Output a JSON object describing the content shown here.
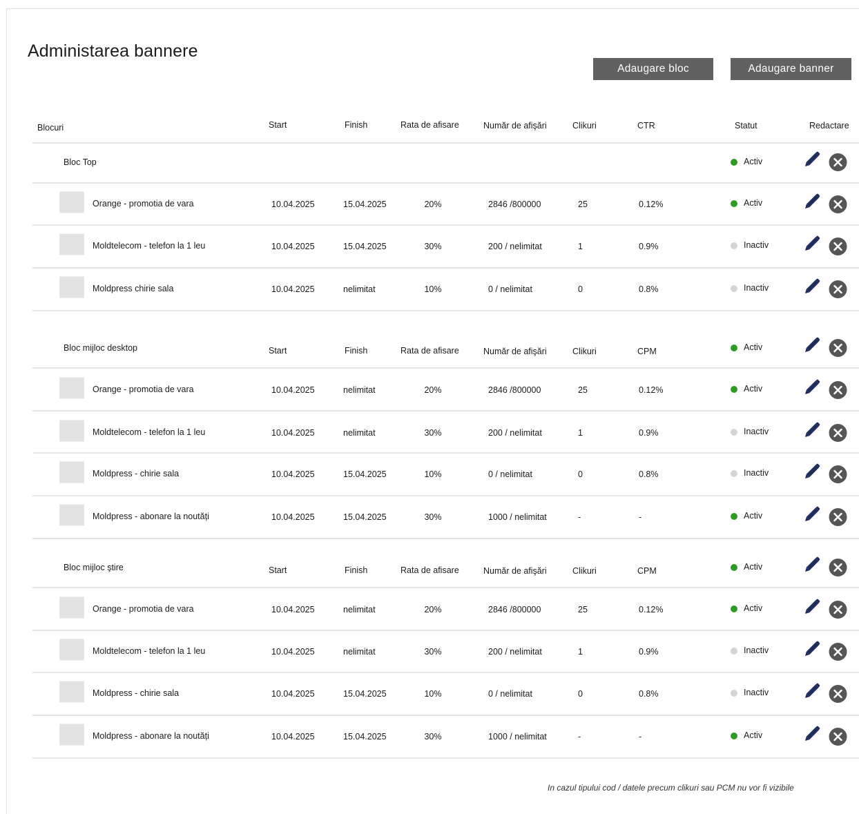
{
  "page": {
    "title": "Administarea bannere"
  },
  "actions": {
    "add_block": "Adaugare bloc",
    "add_banner": "Adaugare banner"
  },
  "columns": {
    "blocks": "Blocuri",
    "start": "Start",
    "finish": "Finish",
    "rate": "Rata de afisare",
    "impressions": "Număr de afişări",
    "clicks": "Clikuri",
    "ctr": "CTR",
    "cpm": "CPM",
    "status": "Statut",
    "edit": "Redactare"
  },
  "colors": {
    "active": "#2f9b24",
    "inactive": "#d4d4d4",
    "button": "#616161",
    "icon": "#1f2d5c",
    "delete": "#555555"
  },
  "icons": {
    "edit": "pencil-icon",
    "delete": "close-circle-icon"
  },
  "blocks": [
    {
      "name": "Bloc Top",
      "status": "Activ",
      "active": true,
      "metric_label": "CTR",
      "banners": [
        {
          "name": "Orange - promotia de vara",
          "start": "10.04.2025",
          "finish": "15.04.2025",
          "rate": "20%",
          "impressions": "2846 /800000",
          "clicks": "25",
          "metric": "0.12%",
          "status": "Activ",
          "active": true
        },
        {
          "name": "Moldtelecom - telefon la 1 leu",
          "start": "10.04.2025",
          "finish": "15.04.2025",
          "rate": "30%",
          "impressions": "200 / nelimitat",
          "clicks": "1",
          "metric": "0.9%",
          "status": "Inactiv",
          "active": false
        },
        {
          "name": "Moldpress chirie sala",
          "start": "10.04.2025",
          "finish": "nelimitat",
          "rate": "10%",
          "impressions": "0 / nelimitat",
          "clicks": "0",
          "metric": "0.8%",
          "status": "Inactiv",
          "active": false
        }
      ]
    },
    {
      "name": "Bloc mijloc desktop",
      "status": "Activ",
      "active": true,
      "metric_label": "CPM",
      "banners": [
        {
          "name": "Orange - promotia de vara",
          "start": "10.04.2025",
          "finish": "nelimitat",
          "rate": "20%",
          "impressions": "2846 /800000",
          "clicks": "25",
          "metric": "0.12%",
          "status": "Activ",
          "active": true
        },
        {
          "name": "Moldtelecom - telefon la 1 leu",
          "start": "10.04.2025",
          "finish": "nelimitat",
          "rate": "30%",
          "impressions": "200 / nelimitat",
          "clicks": "1",
          "metric": "0.9%",
          "status": "Inactiv",
          "active": false
        },
        {
          "name": "Moldpress - chirie sala",
          "start": "10.04.2025",
          "finish": "15.04.2025",
          "rate": "10%",
          "impressions": "0 / nelimitat",
          "clicks": "0",
          "metric": "0.8%",
          "status": "Inactiv",
          "active": false
        },
        {
          "name": "Moldpress - abonare la noutăți",
          "start": "10.04.2025",
          "finish": "15.04.2025",
          "rate": "30%",
          "impressions": "1000 / nelimitat",
          "clicks": "-",
          "metric": "-",
          "status": "Activ",
          "active": true
        }
      ]
    },
    {
      "name": "Bloc mijloc ştire",
      "status": "Activ",
      "active": true,
      "metric_label": "CPM",
      "banners": [
        {
          "name": "Orange - promotia de vara",
          "start": "10.04.2025",
          "finish": "nelimitat",
          "rate": "20%",
          "impressions": "2846 /800000",
          "clicks": "25",
          "metric": "0.12%",
          "status": "Activ",
          "active": true
        },
        {
          "name": "Moldtelecom - telefon la 1 leu",
          "start": "10.04.2025",
          "finish": "nelimitat",
          "rate": "30%",
          "impressions": "200 / nelimitat",
          "clicks": "1",
          "metric": "0.9%",
          "status": "Inactiv",
          "active": false
        },
        {
          "name": "Moldpress - chirie sala",
          "start": "10.04.2025",
          "finish": "15.04.2025",
          "rate": "10%",
          "impressions": "0 / nelimitat",
          "clicks": "0",
          "metric": "0.8%",
          "status": "Inactiv",
          "active": false
        },
        {
          "name": "Moldpress - abonare la noutăți",
          "start": "10.04.2025",
          "finish": "15.04.2025",
          "rate": "30%",
          "impressions": "1000 / nelimitat",
          "clicks": "-",
          "metric": "-",
          "status": "Activ",
          "active": true
        }
      ]
    }
  ],
  "footer": {
    "note": "In cazul tipului cod / datele precum clikuri sau PCM nu vor fi vizibile"
  }
}
